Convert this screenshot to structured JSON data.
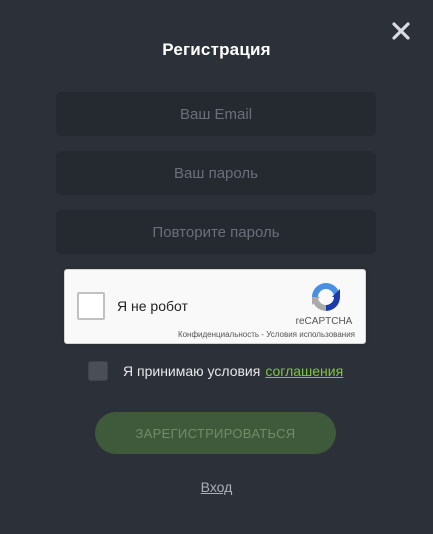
{
  "modal": {
    "title": "Регистрация",
    "close_icon": "close-icon"
  },
  "form": {
    "email": {
      "placeholder": "Ваш Email",
      "value": ""
    },
    "password": {
      "placeholder": "Ваш пароль",
      "value": ""
    },
    "password_repeat": {
      "placeholder": "Повторите пароль",
      "value": ""
    }
  },
  "recaptcha": {
    "label": "Я не робот",
    "brand": "reCAPTCHA",
    "links": "Конфиденциальность - Условия использования",
    "checked": false
  },
  "agreement": {
    "text": "Я принимаю условия",
    "link_text": "соглашения",
    "checked": false
  },
  "actions": {
    "register_label": "ЗАРЕГИСТРИРОВАТЬСЯ",
    "login_label": "Вход"
  },
  "colors": {
    "background": "#2c3038",
    "input_bg": "#252930",
    "accent_link": "#7dc540",
    "button_bg": "#3f5a3b"
  }
}
